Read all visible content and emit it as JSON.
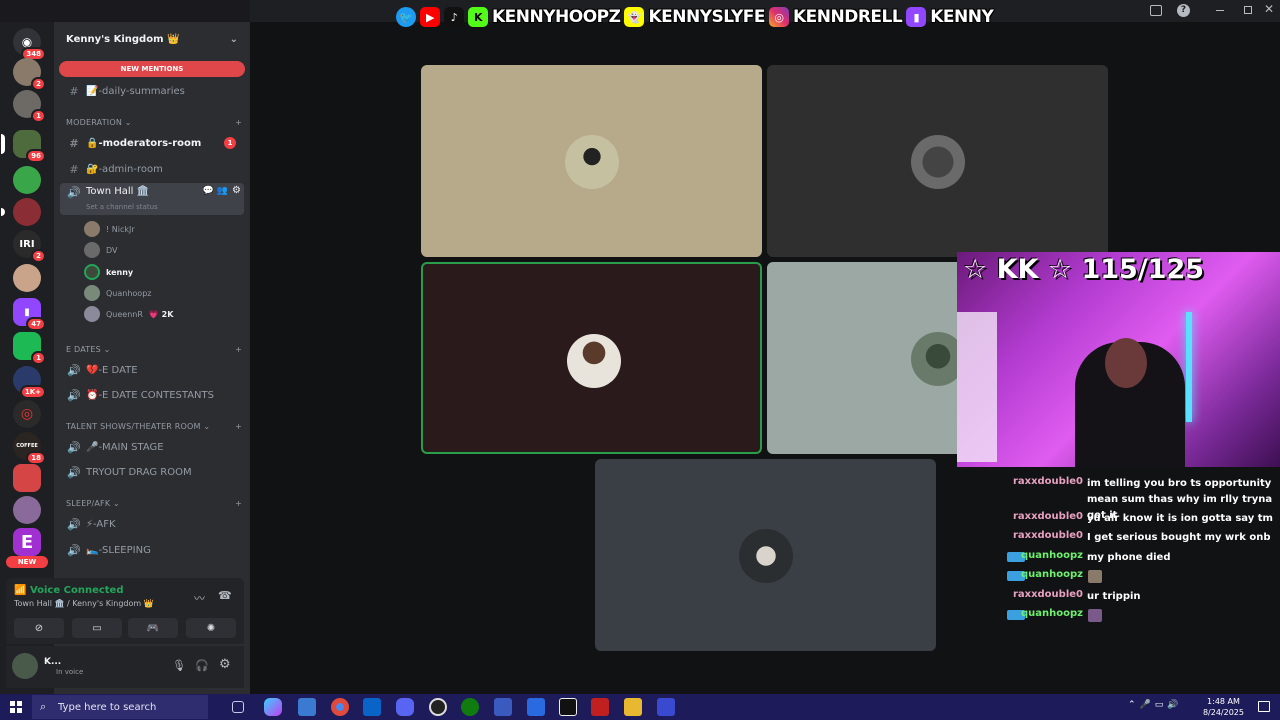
{
  "overlay": {
    "social_handles": [
      "KENNYHOOPZ",
      "KENNYSLYFE",
      "KENNDRELL",
      "KENNY"
    ],
    "webcam_counter": "☆ KK ☆ 115/125"
  },
  "servers": [
    {
      "name": "home",
      "badge": "348"
    },
    {
      "name": "server-2",
      "badge": "2"
    },
    {
      "name": "server-3",
      "badge": "1"
    },
    {
      "name": "server-4",
      "badge": "96"
    },
    {
      "name": "server-5",
      "badge": ""
    },
    {
      "name": "server-6",
      "badge": ""
    },
    {
      "name": "server-7",
      "badge": "2",
      "label": "IRI"
    },
    {
      "name": "server-8",
      "badge": ""
    },
    {
      "name": "server-9",
      "badge": "47"
    },
    {
      "name": "server-10",
      "badge": "1"
    },
    {
      "name": "server-11",
      "badge": "1K+"
    },
    {
      "name": "server-12",
      "badge": ""
    },
    {
      "name": "server-13",
      "badge": "18",
      "label": "COFFEE"
    },
    {
      "name": "server-14",
      "badge": ""
    },
    {
      "name": "server-15",
      "badge": ""
    },
    {
      "name": "server-16",
      "badge": "",
      "label": "E"
    }
  ],
  "new_badge": "NEW",
  "sidebar": {
    "server_name": "Kenny's Kingdom 👑",
    "new_mentions": "NEW MENTIONS",
    "daily_summaries": "📝-daily-summaries",
    "categories": {
      "moderation": "MODERATION",
      "e_dates": "E DATES",
      "talent": "TALENT SHOWS/THEATER ROOM",
      "sleep": "SLEEP/AFK"
    },
    "channels": {
      "moderators_room": "🔒-moderators-room",
      "moderators_unread": "1",
      "admin_room": "🔐-admin-room",
      "town_hall": "Town Hall 🏛️",
      "town_hall_status": "Set a channel status",
      "e_date": "💔-E DATE",
      "e_date_contestants": "⏰-E DATE CONTESTANTS",
      "main_stage": "🎤-MAIN STAGE",
      "tryout": "TRYOUT DRAG ROOM",
      "afk": "⚡-AFK",
      "sleeping": "🛌-SLEEPING"
    },
    "voice_users": [
      {
        "name": "! NickJr",
        "extra": ""
      },
      {
        "name": "DV",
        "extra": ""
      },
      {
        "name": "kenny",
        "extra": ""
      },
      {
        "name": "Quanhoopz",
        "extra": ""
      },
      {
        "name": "QueennR",
        "extra": "💗 2K"
      }
    ]
  },
  "voice_panel": {
    "status": "Voice Connected",
    "location": "Town Hall 🏛️ / Kenny's Kingdom 👑"
  },
  "user_panel": {
    "name": "K...",
    "status": "In voice"
  },
  "chat": [
    {
      "user": "raxxdouble0",
      "text": "im telling you bro ts opportunity mean sum thas why im rlly tryna get it",
      "color": "#e8a0c0"
    },
    {
      "user": "raxxdouble0",
      "text": "yu alr know it is ion gotta say tm",
      "color": "#e8a0c0"
    },
    {
      "user": "raxxdouble0",
      "text": "I get serious bought my wrk onb",
      "color": "#e8a0c0"
    },
    {
      "user": "quanhoopz",
      "text": "my phone died",
      "color": "#6ef06e"
    },
    {
      "user": "quanhoopz",
      "text": "",
      "color": "#6ef06e"
    },
    {
      "user": "raxxdouble0",
      "text": "ur trippin",
      "color": "#e8a0c0"
    },
    {
      "user": "quanhoopz",
      "text": "",
      "color": "#6ef06e"
    }
  ],
  "taskbar": {
    "search_placeholder": "Type here to search",
    "time": "1:48 AM",
    "date": "8/24/2025"
  }
}
